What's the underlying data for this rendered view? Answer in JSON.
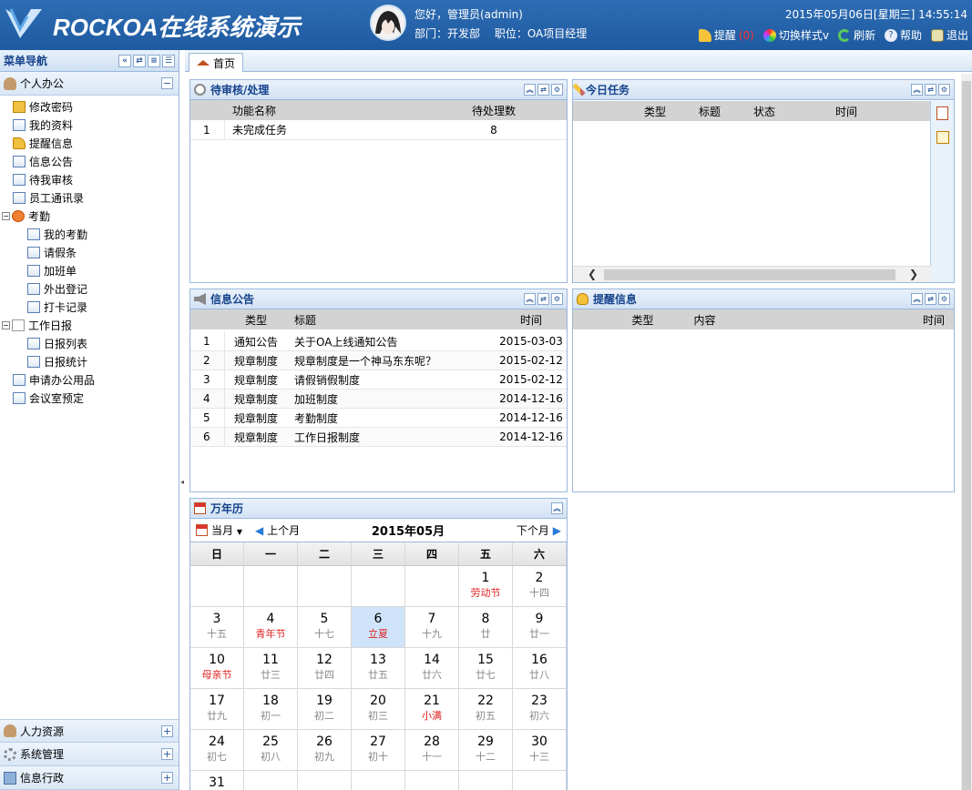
{
  "header": {
    "title": "ROCKOA在线系统演示",
    "greeting": "您好，管理员(admin)",
    "dept": "部门：开发部　 职位：OA项目经理",
    "datetime": "2015年05月06日[星期三] 14:55:14",
    "actions": [
      {
        "label": "提醒",
        "badge": "(0)",
        "icon": "bell-icon"
      },
      {
        "label": "切换样式v",
        "icon": "palette-icon"
      },
      {
        "label": "刷新",
        "icon": "refresh-icon"
      },
      {
        "label": "帮助",
        "icon": "help-icon"
      },
      {
        "label": "退出",
        "icon": "logout-icon"
      }
    ]
  },
  "sidebar": {
    "title": "菜单导航",
    "group1": "个人办公",
    "items": [
      {
        "label": "修改密码"
      },
      {
        "label": "我的资料"
      },
      {
        "label": "提醒信息"
      },
      {
        "label": "信息公告"
      },
      {
        "label": "待我审核"
      },
      {
        "label": "员工通讯录"
      },
      {
        "label": "考勤"
      },
      {
        "label": "我的考勤"
      },
      {
        "label": "请假条"
      },
      {
        "label": "加班单"
      },
      {
        "label": "外出登记"
      },
      {
        "label": "打卡记录"
      },
      {
        "label": "工作日报"
      },
      {
        "label": "日报列表"
      },
      {
        "label": "日报统计"
      },
      {
        "label": "申请办公用品"
      },
      {
        "label": "会议室预定"
      }
    ],
    "bottom": [
      "人力资源",
      "系统管理",
      "信息行政"
    ]
  },
  "tabs": {
    "home": "首页"
  },
  "pending": {
    "title": "待审核/处理",
    "columns": [
      "功能名称",
      "待处理数"
    ],
    "rows": [
      {
        "no": "1",
        "name": "未完成任务",
        "count": "8"
      }
    ]
  },
  "today": {
    "title": "今日任务",
    "columns": [
      "类型",
      "标题",
      "状态",
      "时间"
    ]
  },
  "notice": {
    "title": "信息公告",
    "columns": [
      "类型",
      "标题",
      "时间"
    ],
    "rows": [
      {
        "no": "1",
        "type": "通知公告",
        "title": "关于OA上线通知公告",
        "time": "2015-03-03"
      },
      {
        "no": "2",
        "type": "规章制度",
        "title": "规章制度是一个神马东东呢？",
        "time": "2015-02-12"
      },
      {
        "no": "3",
        "type": "规章制度",
        "title": "请假销假制度",
        "time": "2015-02-12"
      },
      {
        "no": "4",
        "type": "规章制度",
        "title": "加班制度",
        "time": "2014-12-16"
      },
      {
        "no": "5",
        "type": "规章制度",
        "title": "考勤制度",
        "time": "2014-12-16"
      },
      {
        "no": "6",
        "type": "规章制度",
        "title": "工作日报制度",
        "time": "2014-12-16"
      }
    ]
  },
  "remind": {
    "title": "提醒信息",
    "columns": [
      "类型",
      "内容",
      "时间"
    ]
  },
  "calendar": {
    "title": "万年历",
    "this_month": "当月",
    "prev": "上个月",
    "next": "下个月",
    "month_title": "2015年05月",
    "weekdays": [
      "日",
      "一",
      "二",
      "三",
      "四",
      "五",
      "六"
    ],
    "cells": [
      {
        "d": "",
        "l": ""
      },
      {
        "d": "",
        "l": ""
      },
      {
        "d": "",
        "l": ""
      },
      {
        "d": "",
        "l": ""
      },
      {
        "d": "",
        "l": ""
      },
      {
        "d": "1",
        "l": "劳动节",
        "fest": true
      },
      {
        "d": "2",
        "l": "十四"
      },
      {
        "d": "3",
        "l": "十五"
      },
      {
        "d": "4",
        "l": "青年节",
        "fest": true
      },
      {
        "d": "5",
        "l": "十七"
      },
      {
        "d": "6",
        "l": "立夏",
        "fest": true,
        "today": true
      },
      {
        "d": "7",
        "l": "十九"
      },
      {
        "d": "8",
        "l": "廿"
      },
      {
        "d": "9",
        "l": "廿一"
      },
      {
        "d": "10",
        "l": "母亲节",
        "fest": true
      },
      {
        "d": "11",
        "l": "廿三"
      },
      {
        "d": "12",
        "l": "廿四"
      },
      {
        "d": "13",
        "l": "廿五"
      },
      {
        "d": "14",
        "l": "廿六"
      },
      {
        "d": "15",
        "l": "廿七"
      },
      {
        "d": "16",
        "l": "廿八"
      },
      {
        "d": "17",
        "l": "廿九"
      },
      {
        "d": "18",
        "l": "初一"
      },
      {
        "d": "19",
        "l": "初二"
      },
      {
        "d": "20",
        "l": "初三"
      },
      {
        "d": "21",
        "l": "小满",
        "fest": true
      },
      {
        "d": "22",
        "l": "初五"
      },
      {
        "d": "23",
        "l": "初六"
      },
      {
        "d": "24",
        "l": "初七"
      },
      {
        "d": "25",
        "l": "初八"
      },
      {
        "d": "26",
        "l": "初九"
      },
      {
        "d": "27",
        "l": "初十"
      },
      {
        "d": "28",
        "l": "十一"
      },
      {
        "d": "29",
        "l": "十二"
      },
      {
        "d": "30",
        "l": "十三"
      },
      {
        "d": "31",
        "l": ""
      },
      {
        "d": "",
        "l": ""
      },
      {
        "d": "",
        "l": ""
      },
      {
        "d": "",
        "l": ""
      },
      {
        "d": "",
        "l": ""
      },
      {
        "d": "",
        "l": ""
      },
      {
        "d": "",
        "l": ""
      }
    ]
  },
  "colors": {
    "header": "#1e5aa0",
    "panel_title": "#15428b",
    "festival": "#e02020",
    "today": "#cfe4fa"
  }
}
